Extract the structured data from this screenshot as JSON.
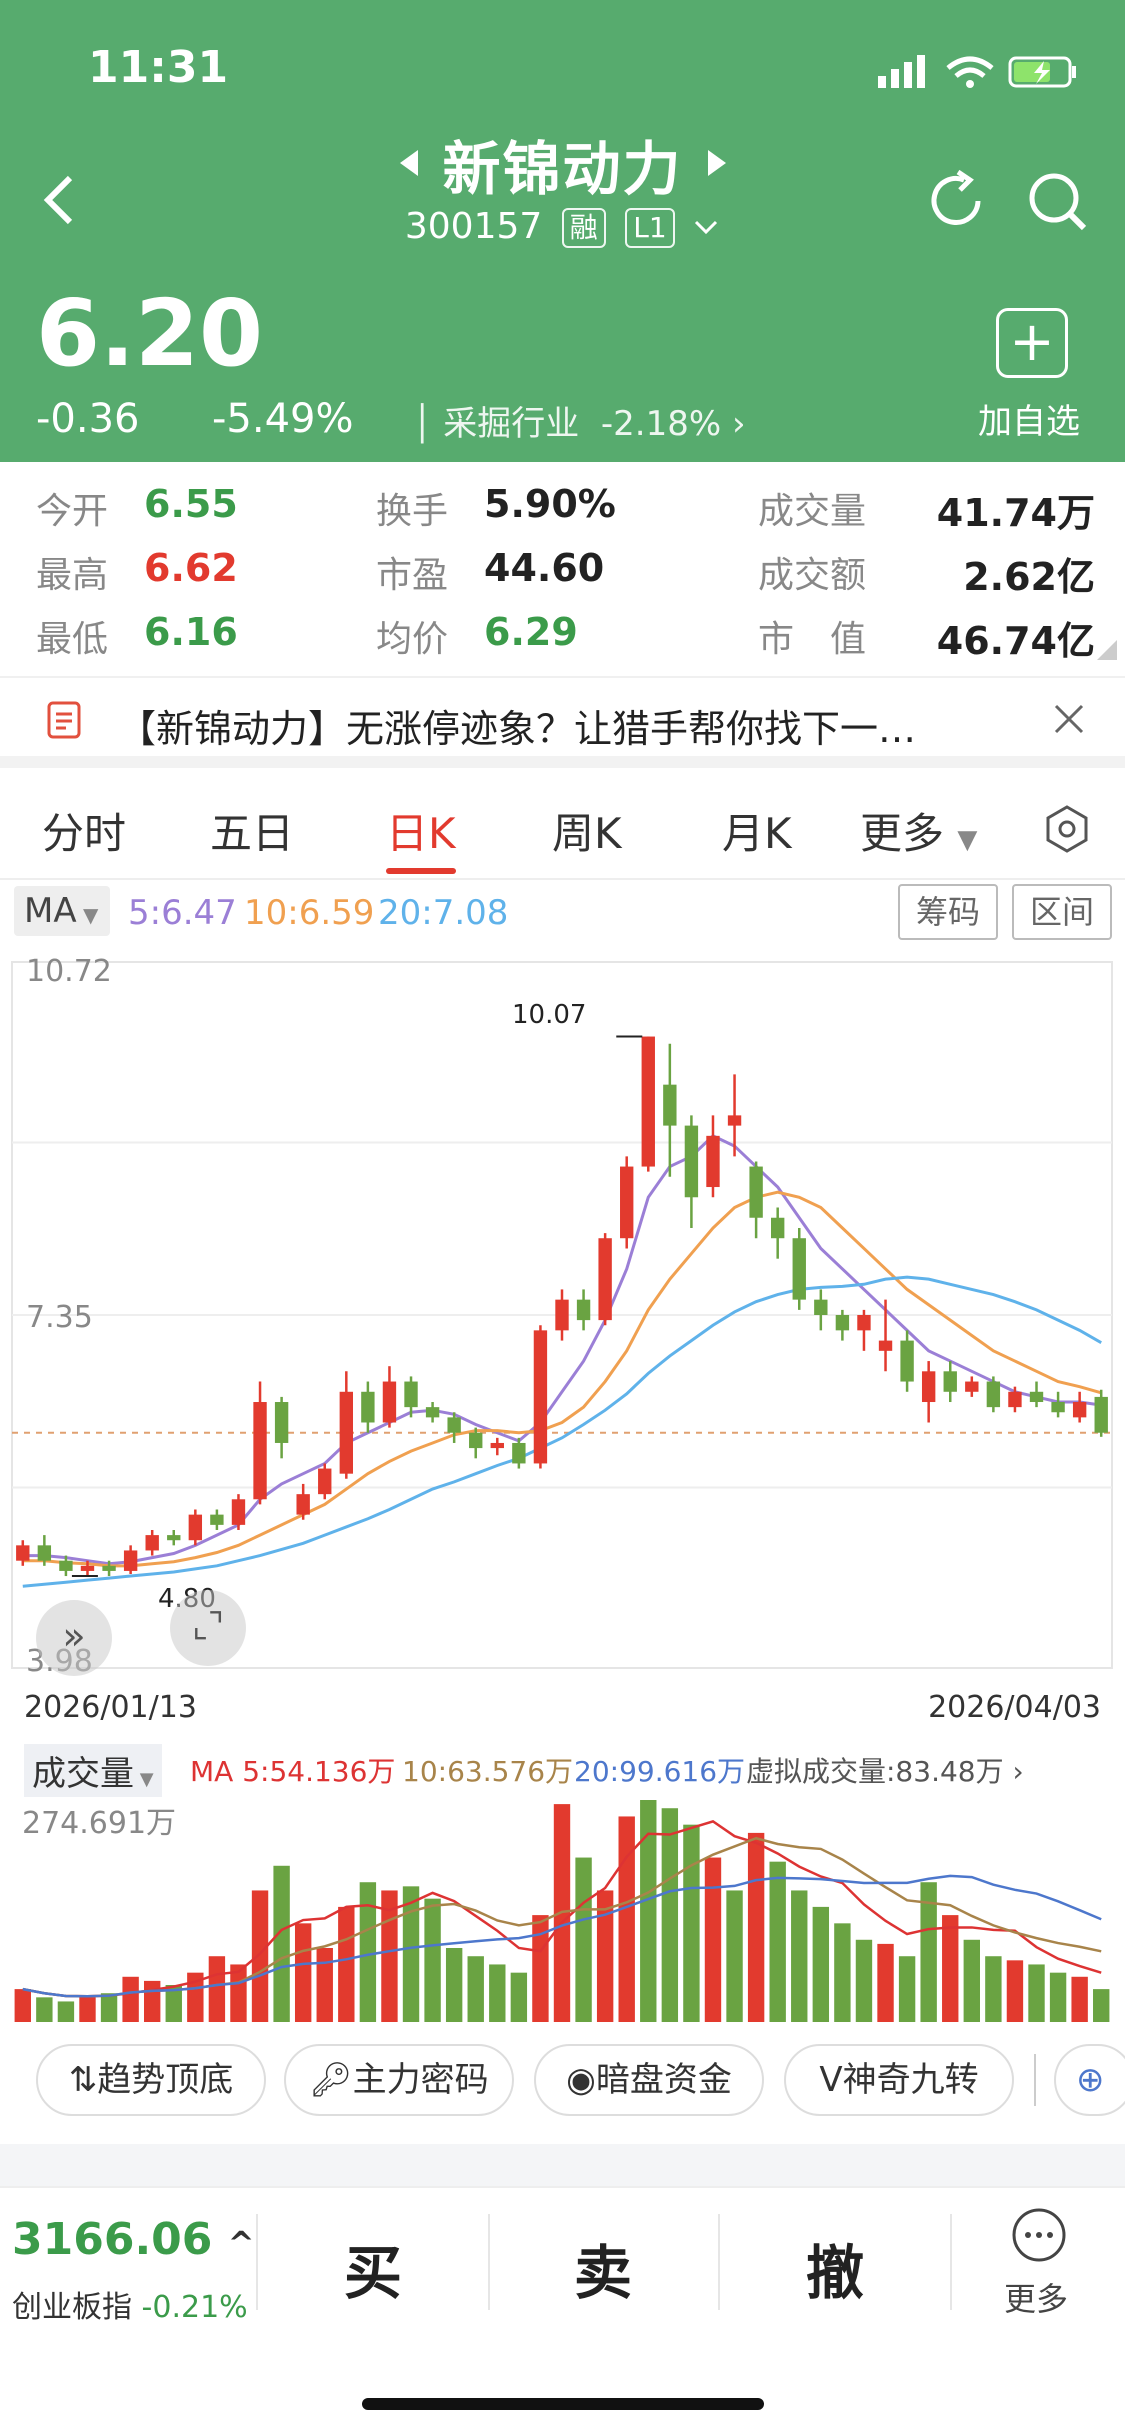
{
  "status": {
    "time": "11:31"
  },
  "header": {
    "name": "新锦动力",
    "code": "300157",
    "tag_rong": "融",
    "tag_level": "L1",
    "price": "6.20",
    "change": "-0.36",
    "change_pct": "-5.49%",
    "industry": "采掘行业",
    "industry_pct": "-2.18%",
    "add_label": "加自选"
  },
  "stats": {
    "open": {
      "label": "今开",
      "value": "6.55"
    },
    "high": {
      "label": "最高",
      "value": "6.62"
    },
    "low": {
      "label": "最低",
      "value": "6.16"
    },
    "turnover": {
      "label": "换手",
      "value": "5.90%"
    },
    "pe": {
      "label": "市盈",
      "value": "44.60"
    },
    "avg": {
      "label": "均价",
      "value": "6.29"
    },
    "volume": {
      "label": "成交量",
      "value": "41.74万"
    },
    "amount": {
      "label": "成交额",
      "value": "2.62亿"
    },
    "mcap": {
      "label": "市　值",
      "value": "46.74亿"
    }
  },
  "news": {
    "text": "【新锦动力】无涨停迹象？让猎手帮你找下一…"
  },
  "tabs": [
    "分时",
    "五日",
    "日K",
    "周K",
    "月K",
    "更多"
  ],
  "ma_bar": {
    "selector": "MA",
    "ma5": "5:6.47",
    "ma10": "10:6.59",
    "ma20": "20:7.08",
    "chip_btn": "筹码",
    "range_btn": "区间"
  },
  "colors": {
    "up": "#e23a2e",
    "down": "#6aa342",
    "ma5": "#9b7fd6",
    "ma10": "#f0a050",
    "ma20": "#5fb2ea",
    "header": "#57ab6e"
  },
  "chart_data": {
    "type": "candlestick",
    "y_max_label": "10.72",
    "y_mid_label": "7.35",
    "y_min_label": "3.98",
    "ylim": [
      3.98,
      10.72
    ],
    "start_date": "2026/01/13",
    "end_date": "2026/04/03",
    "high_mark": "10.07",
    "low_mark": "4.80",
    "candles": [
      [
        4.95,
        5.1,
        5.15,
        4.9
      ],
      [
        5.1,
        4.95,
        5.2,
        4.9
      ],
      [
        4.95,
        4.85,
        5.0,
        4.8
      ],
      [
        4.85,
        4.9,
        4.95,
        4.8
      ],
      [
        4.9,
        4.85,
        4.95,
        4.8
      ],
      [
        4.85,
        5.05,
        5.1,
        4.82
      ],
      [
        5.05,
        5.2,
        5.25,
        5.0
      ],
      [
        5.2,
        5.15,
        5.25,
        5.1
      ],
      [
        5.15,
        5.4,
        5.45,
        5.1
      ],
      [
        5.4,
        5.3,
        5.45,
        5.25
      ],
      [
        5.3,
        5.55,
        5.6,
        5.25
      ],
      [
        5.55,
        6.5,
        6.7,
        5.5
      ],
      [
        6.5,
        6.1,
        6.55,
        5.95
      ],
      [
        5.4,
        5.6,
        5.7,
        5.35
      ],
      [
        5.6,
        5.85,
        5.9,
        5.55
      ],
      [
        5.8,
        6.6,
        6.8,
        5.75
      ],
      [
        6.6,
        6.3,
        6.7,
        6.2
      ],
      [
        6.3,
        6.7,
        6.85,
        6.25
      ],
      [
        6.7,
        6.45,
        6.75,
        6.35
      ],
      [
        6.45,
        6.35,
        6.5,
        6.3
      ],
      [
        6.35,
        6.2,
        6.4,
        6.1
      ],
      [
        6.2,
        6.05,
        6.25,
        5.95
      ],
      [
        6.05,
        6.1,
        6.15,
        5.98
      ],
      [
        6.1,
        5.9,
        6.15,
        5.85
      ],
      [
        5.9,
        7.2,
        7.25,
        5.85
      ],
      [
        7.2,
        7.5,
        7.6,
        7.1
      ],
      [
        7.5,
        7.3,
        7.6,
        7.2
      ],
      [
        7.3,
        8.1,
        8.15,
        7.25
      ],
      [
        8.1,
        8.8,
        8.9,
        8.0
      ],
      [
        8.8,
        10.07,
        10.07,
        8.75
      ],
      [
        9.6,
        9.2,
        10.0,
        8.7
      ],
      [
        9.2,
        8.5,
        9.3,
        8.2
      ],
      [
        8.6,
        9.1,
        9.3,
        8.5
      ],
      [
        9.2,
        9.3,
        9.7,
        8.9
      ],
      [
        8.8,
        8.3,
        8.85,
        8.1
      ],
      [
        8.3,
        8.1,
        8.4,
        7.9
      ],
      [
        8.1,
        7.5,
        8.2,
        7.4
      ],
      [
        7.5,
        7.35,
        7.6,
        7.2
      ],
      [
        7.35,
        7.2,
        7.4,
        7.1
      ],
      [
        7.2,
        7.35,
        7.4,
        7.0
      ],
      [
        7.0,
        7.1,
        7.5,
        6.8
      ],
      [
        7.1,
        6.7,
        7.2,
        6.6
      ],
      [
        6.5,
        6.8,
        6.9,
        6.3
      ],
      [
        6.8,
        6.6,
        6.9,
        6.5
      ],
      [
        6.6,
        6.7,
        6.75,
        6.55
      ],
      [
        6.7,
        6.45,
        6.75,
        6.4
      ],
      [
        6.45,
        6.6,
        6.65,
        6.4
      ],
      [
        6.6,
        6.5,
        6.7,
        6.45
      ],
      [
        6.5,
        6.4,
        6.6,
        6.35
      ],
      [
        6.35,
        6.5,
        6.6,
        6.3
      ],
      [
        6.55,
        6.2,
        6.62,
        6.16
      ]
    ],
    "ma5": [
      5.0,
      5.0,
      4.98,
      4.95,
      4.92,
      4.94,
      4.98,
      5.02,
      5.1,
      5.2,
      5.3,
      5.55,
      5.7,
      5.8,
      5.9,
      6.1,
      6.2,
      6.3,
      6.4,
      6.42,
      6.38,
      6.28,
      6.2,
      6.12,
      6.3,
      6.6,
      6.9,
      7.3,
      7.8,
      8.5,
      8.8,
      8.9,
      9.1,
      9.0,
      8.8,
      8.6,
      8.3,
      8.0,
      7.8,
      7.6,
      7.4,
      7.2,
      7.0,
      6.9,
      6.8,
      6.7,
      6.6,
      6.55,
      6.5,
      6.5,
      6.47
    ],
    "ma10": [
      4.95,
      4.95,
      4.93,
      4.92,
      4.9,
      4.9,
      4.92,
      4.94,
      4.98,
      5.03,
      5.1,
      5.2,
      5.3,
      5.4,
      5.5,
      5.65,
      5.8,
      5.92,
      6.02,
      6.1,
      6.18,
      6.22,
      6.22,
      6.2,
      6.22,
      6.3,
      6.45,
      6.7,
      7.0,
      7.4,
      7.7,
      7.95,
      8.2,
      8.4,
      8.5,
      8.55,
      8.5,
      8.4,
      8.2,
      8.0,
      7.8,
      7.6,
      7.45,
      7.3,
      7.15,
      7.0,
      6.9,
      6.8,
      6.7,
      6.65,
      6.59
    ],
    "ma20": [
      4.7,
      4.72,
      4.74,
      4.76,
      4.78,
      4.8,
      4.82,
      4.84,
      4.87,
      4.9,
      4.95,
      5.0,
      5.06,
      5.12,
      5.2,
      5.28,
      5.36,
      5.45,
      5.55,
      5.65,
      5.72,
      5.8,
      5.88,
      5.95,
      6.05,
      6.15,
      6.28,
      6.42,
      6.58,
      6.78,
      6.95,
      7.1,
      7.25,
      7.38,
      7.48,
      7.55,
      7.6,
      7.62,
      7.63,
      7.65,
      7.7,
      7.72,
      7.7,
      7.65,
      7.6,
      7.55,
      7.48,
      7.4,
      7.3,
      7.2,
      7.08
    ]
  },
  "volume": {
    "label": "成交量",
    "ma5": "MA 5:54.136万",
    "ma10": "10:63.576万",
    "ma20": "20:99.616万",
    "virtual": "虚拟成交量:83.48万",
    "max_label": "274.691万",
    "values": [
      40,
      30,
      25,
      30,
      35,
      55,
      50,
      45,
      60,
      80,
      70,
      160,
      190,
      120,
      90,
      140,
      170,
      160,
      165,
      150,
      90,
      80,
      70,
      60,
      130,
      265,
      200,
      160,
      250,
      270,
      260,
      240,
      200,
      160,
      230,
      195,
      160,
      140,
      120,
      100,
      95,
      80,
      170,
      130,
      100,
      80,
      75,
      70,
      60,
      55,
      40
    ],
    "up": [
      1,
      0,
      0,
      1,
      0,
      1,
      1,
      0,
      1,
      1,
      1,
      1,
      0,
      1,
      1,
      1,
      0,
      1,
      0,
      0,
      0,
      0,
      0,
      0,
      1,
      1,
      0,
      1,
      1,
      0,
      0,
      0,
      1,
      0,
      1,
      0,
      0,
      0,
      0,
      0,
      1,
      0,
      0,
      1,
      0,
      0,
      1,
      0,
      0,
      1,
      0
    ]
  },
  "indicators": [
    "趋势顶底",
    "主力密码",
    "暗盘资金",
    "神奇九转"
  ],
  "bottom": {
    "index_value": "3166.06",
    "index_name": "创业板指",
    "index_pct": "-0.21%",
    "buy": "买",
    "sell": "卖",
    "cancel": "撤",
    "more": "更多"
  }
}
